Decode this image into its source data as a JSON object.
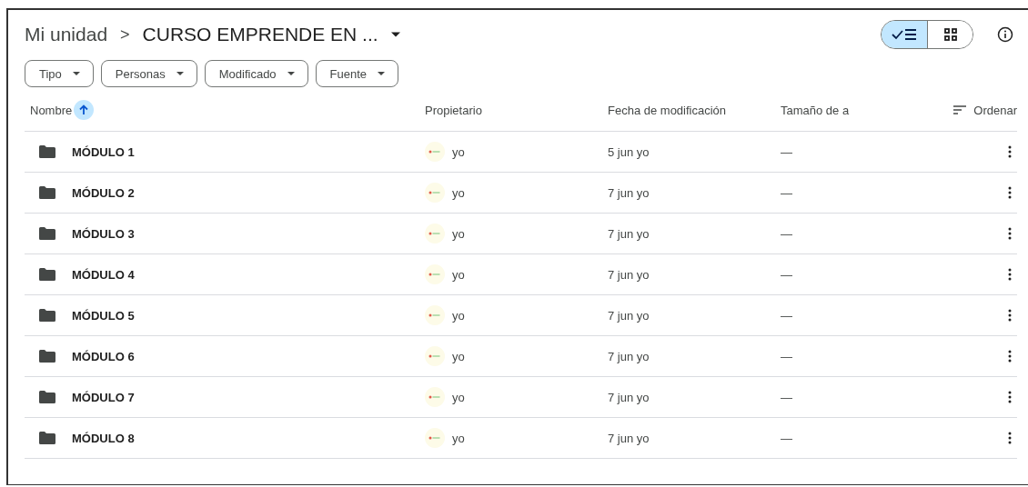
{
  "breadcrumb": {
    "root": "Mi unidad",
    "separator": ">",
    "current": "CURSO EMPRENDE EN ..."
  },
  "view_toggle": [
    {
      "kind": "list",
      "selected": true
    },
    {
      "kind": "grid",
      "selected": false
    }
  ],
  "filters": [
    {
      "label": "Tipo"
    },
    {
      "label": "Personas"
    },
    {
      "label": "Modificado"
    },
    {
      "label": "Fuente"
    }
  ],
  "table": {
    "columns": [
      {
        "label": "Nombre",
        "sorted": true
      },
      {
        "label": "Propietario",
        "sorted": false
      },
      {
        "label": "Fecha de modificación",
        "sorted": false
      },
      {
        "label": "Tamaño de a",
        "sorted": false
      }
    ],
    "sort_button": "Ordenar",
    "rows": [
      {
        "name": "MÓDULO 1",
        "owner": "yo",
        "modified": "5 jun yo",
        "size": "—"
      },
      {
        "name": "MÓDULO 2",
        "owner": "yo",
        "modified": "7 jun yo",
        "size": "—"
      },
      {
        "name": "MÓDULO 3",
        "owner": "yo",
        "modified": "7 jun yo",
        "size": "—"
      },
      {
        "name": "MÓDULO 4",
        "owner": "yo",
        "modified": "7 jun yo",
        "size": "—"
      },
      {
        "name": "MÓDULO 5",
        "owner": "yo",
        "modified": "7 jun yo",
        "size": "—"
      },
      {
        "name": "MÓDULO 6",
        "owner": "yo",
        "modified": "7 jun yo",
        "size": "—"
      },
      {
        "name": "MÓDULO 7",
        "owner": "yo",
        "modified": "7 jun yo",
        "size": "—"
      },
      {
        "name": "MÓDULO 8",
        "owner": "yo",
        "modified": "7 jun yo",
        "size": "—"
      }
    ]
  }
}
